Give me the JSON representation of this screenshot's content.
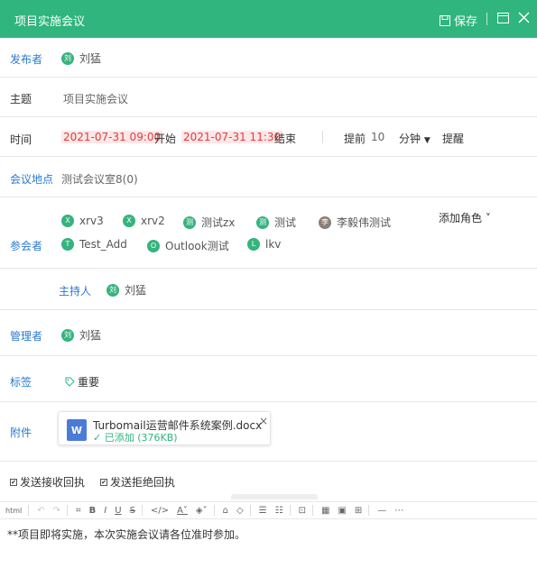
{
  "window": {
    "title": "项目实施会议",
    "save_label": "保存"
  },
  "publisher": {
    "label": "发布者",
    "avatar": "刘",
    "name": "刘猛"
  },
  "subject": {
    "label": "主题",
    "value": "项目实施会议"
  },
  "time": {
    "label": "时间",
    "start": "2021-07-31 09:00",
    "start_word": "开始",
    "end": "2021-07-31 11:30",
    "end_word": "结束",
    "advance_label": "提前",
    "advance_value": "10",
    "unit": "分钟",
    "unit_arrow": "▼",
    "remind_label": "提醒"
  },
  "location": {
    "label": "会议地点",
    "value": "测试会议室8(0)"
  },
  "attendees": {
    "label": "参会者",
    "add_role": "添加角色",
    "add_role_arrow": "˅",
    "people": [
      {
        "avatar": "X",
        "name": "xrv3"
      },
      {
        "avatar": "X",
        "name": "xrv2"
      },
      {
        "avatar": "测",
        "name": "测试zx"
      },
      {
        "avatar": "测",
        "name": "测试"
      },
      {
        "avatar": "李",
        "name": "李毅伟测试"
      },
      {
        "avatar": "T",
        "name": "Test_Add"
      },
      {
        "avatar": "O",
        "name": "Outlook测试"
      },
      {
        "avatar": "L",
        "name": "lkv"
      }
    ]
  },
  "host": {
    "label": "主持人",
    "avatar": "刘",
    "name": "刘猛"
  },
  "manager": {
    "label": "管理者",
    "avatar": "刘",
    "name": "刘猛"
  },
  "tags": {
    "label": "标签",
    "value": "重要"
  },
  "attachment": {
    "label": "附件",
    "file_icon": "W",
    "filename": "Turbomail运营邮件系统案例.docx",
    "status": "✓ 已添加 (376KB)",
    "close": "×"
  },
  "options": {
    "receipt_accept": "发送接收回执",
    "receipt_reject": "发送拒绝回执",
    "check_mark": "✔"
  },
  "toolbar": {
    "items": [
      "html",
      "↶",
      "↷",
      "⌗",
      "B",
      "I",
      "U",
      "S",
      "</>",
      "A˅",
      "◈˅",
      "⌂",
      "◇",
      "☰",
      "☷",
      "⊡",
      "▦",
      "▣",
      "⊞",
      "—",
      "⋯"
    ]
  },
  "editor": {
    "content": "**项目即将实施，本次实施会议请各位准时参加。"
  },
  "colors": {
    "accent": "#2fb57d",
    "label_blue": "#2a7ad2",
    "time_red": "#e03c3c"
  }
}
